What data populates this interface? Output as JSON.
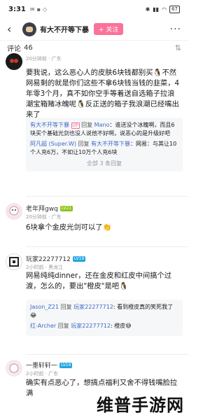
{
  "status": {
    "time": "3:31",
    "battery": "67"
  },
  "nav": {
    "back_icon": "chevron-left-icon",
    "title": "有大不开等下暴",
    "follow_label": "+ 关注"
  },
  "section": {
    "label": "评论",
    "count": "46"
  },
  "comments": [
    {
      "time": "20分钟前 · 广东",
      "text_a": "要我说，这么恶心人的皮肤6块钱都别买",
      "text_emoji": "🐧",
      "text_b": "不然网易剩的就是你们这些不拿6块钱当钱的韭菜，4年零3个月，真不如你空手等着送自选箱子拉浪潮宝箱赌冰魄呢",
      "text_emoji2": "🐧",
      "text_c": "反正送的箱子我浪潮已经嘴出来了",
      "replies": [
        {
          "name": "有大不开等下暴",
          "tag": "UP",
          "prefix": "回复 ",
          "mention": "Mano",
          "text": "：谁送没个冰魄啊，而且6块买个基础光剑也没人说他不好啊，说恶心的是升级好吧"
        },
        {
          "name": "阿凡超 (Super.W)",
          "prefix": " 回复 ",
          "mention": "有大不开等下暴",
          "text": "：网易：与其让10个人充6万，不如让10万个人充6块"
        }
      ],
      "more_replies": "全部 3 条回复"
    },
    {
      "name": "老年拜gwq",
      "level": "LV21",
      "time": "20分钟前 · 广东",
      "text": "6块拿个金皮光剑可以了",
      "emoji": "👏"
    },
    {
      "name": "玩家22277712",
      "level": "LV19",
      "time": "2小时前 · 黑龙江",
      "text": "网易纯纯dinner，还在金皮和红皮中间搞个过渡，怎么的，要出\"橙皮\"是吧",
      "emoji": "🐧",
      "replies": [
        {
          "name": "Jason_Z21",
          "prefix": " 回复 ",
          "mention": "玩家22277712",
          "text": ": 看到橙皮真的笑死我了",
          "emoji": "😂"
        },
        {
          "name": "红-Archer",
          "prefix": " 回复 ",
          "mention": "玩家22277712",
          "text": ": 橙皮",
          "emoji": "😅"
        }
      ]
    },
    {
      "name": "一墨轩轩一",
      "level": "LV19",
      "time": "2小时前 · 广东",
      "text": "确实有点恶心了，想搞点福利又舍不得钱嘴脸拉满"
    }
  ],
  "watermark": "维普手游网"
}
